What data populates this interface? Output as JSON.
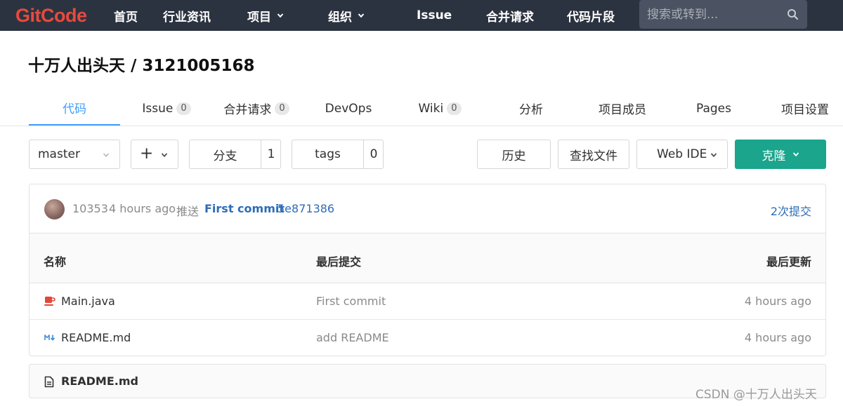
{
  "navbar": {
    "logo": "GitCode",
    "items": [
      "首页",
      "行业资讯",
      "项目",
      "组织",
      "Issue",
      "合并请求",
      "代码片段"
    ],
    "search_placeholder": "搜索或转到..."
  },
  "project": {
    "title": "十万人出头天 / 3121005168"
  },
  "tabs": [
    {
      "label": "代码",
      "count": null,
      "active": true
    },
    {
      "label": "Issue",
      "count": "0"
    },
    {
      "label": "合并请求",
      "count": "0"
    },
    {
      "label": "DevOps",
      "count": null
    },
    {
      "label": "Wiki",
      "count": "0"
    },
    {
      "label": "分析",
      "count": null
    },
    {
      "label": "项目成员",
      "count": null
    },
    {
      "label": "Pages",
      "count": null
    },
    {
      "label": "项目设置",
      "count": null
    }
  ],
  "toolbar": {
    "branch": "master",
    "add_label": "+",
    "branches_label": "分支",
    "branches_count": "1",
    "tags_label": "tags",
    "tags_count": "0",
    "history_label": "历史",
    "find_file_label": "查找文件",
    "web_ide_label": "Web IDE",
    "clone_label": "克隆"
  },
  "last_commit": {
    "author": "10353",
    "time": "4 hours ago",
    "action": "推送",
    "message": "First commit",
    "sha": "5e871386",
    "commit_count": "2次提交"
  },
  "table": {
    "headers": [
      "名称",
      "最后提交",
      "最后更新"
    ],
    "rows": [
      {
        "name": "Main.java",
        "icon": "java-icon",
        "commit": "First commit",
        "updated": "4 hours ago"
      },
      {
        "name": "README.md",
        "icon": "markdown-icon",
        "commit": "add README",
        "updated": "4 hours ago"
      }
    ]
  },
  "readme": {
    "title": "README.md"
  },
  "watermark": "CSDN @十万人出头天",
  "colors": {
    "navbar_bg": "#2c3340",
    "logo": "#e84a3d",
    "link": "#2e6db7",
    "active_tab": "#409eff",
    "primary_button": "#1aa58c"
  }
}
